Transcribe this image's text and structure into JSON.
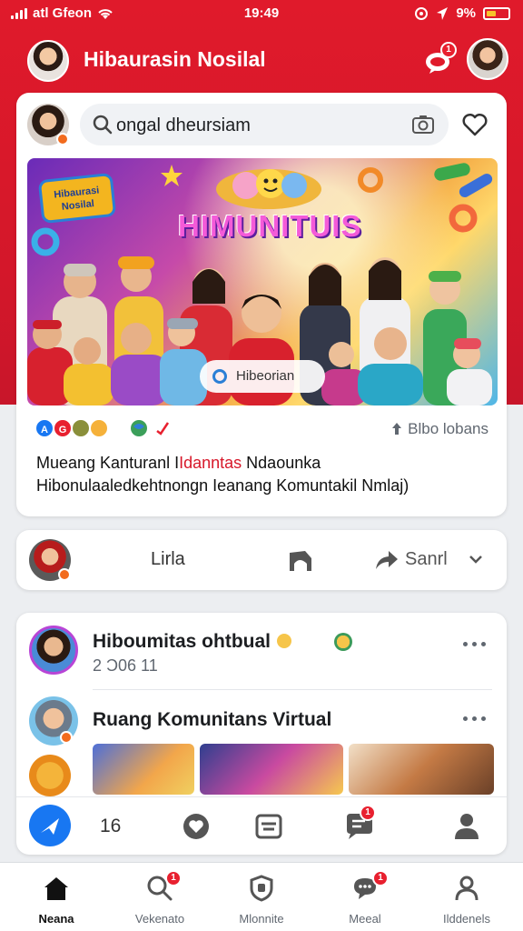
{
  "status": {
    "carrier": "atl Gfeon",
    "time": "19:49",
    "battery": "9%"
  },
  "header": {
    "title": "Hibaurasin Nosilal",
    "notif_badge": "1"
  },
  "post": {
    "search_value": "ongal dheursiam",
    "hero_sign": "Hibaurasi Nosilal",
    "hero_headline": "HIMUNITUIS",
    "hero_pill": "Hibeorian",
    "reactions": [
      "A",
      "G"
    ],
    "shares": "Blbo lobans",
    "caption_prefix": "Mueang Kanturanl I",
    "caption_highlight": "Idanntas",
    "caption_suffix": " Ndaounka",
    "caption_line2": "Hibonulaaledkehtnongn Ieanang Komuntakil Nmlaj)"
  },
  "actions": {
    "like_label": "Lirla",
    "share_label": "Sanrl"
  },
  "feed": {
    "item1": {
      "name": "Hiboumitas ohtbual",
      "time": "2 Ɔ06 11"
    },
    "item2": {
      "name": "Ruang Komunitans Virtual"
    }
  },
  "quickbar": {
    "count": "16",
    "badge": "1"
  },
  "tabs": [
    {
      "label": "Neana"
    },
    {
      "label": "Vekenato",
      "badge": "1"
    },
    {
      "label": "Mlonnite"
    },
    {
      "label": "Meeal",
      "badge": "1"
    },
    {
      "label": "Ilddenels"
    }
  ],
  "colors": {
    "brand_red": "#e01a2b",
    "accent_blue": "#1877f2"
  }
}
